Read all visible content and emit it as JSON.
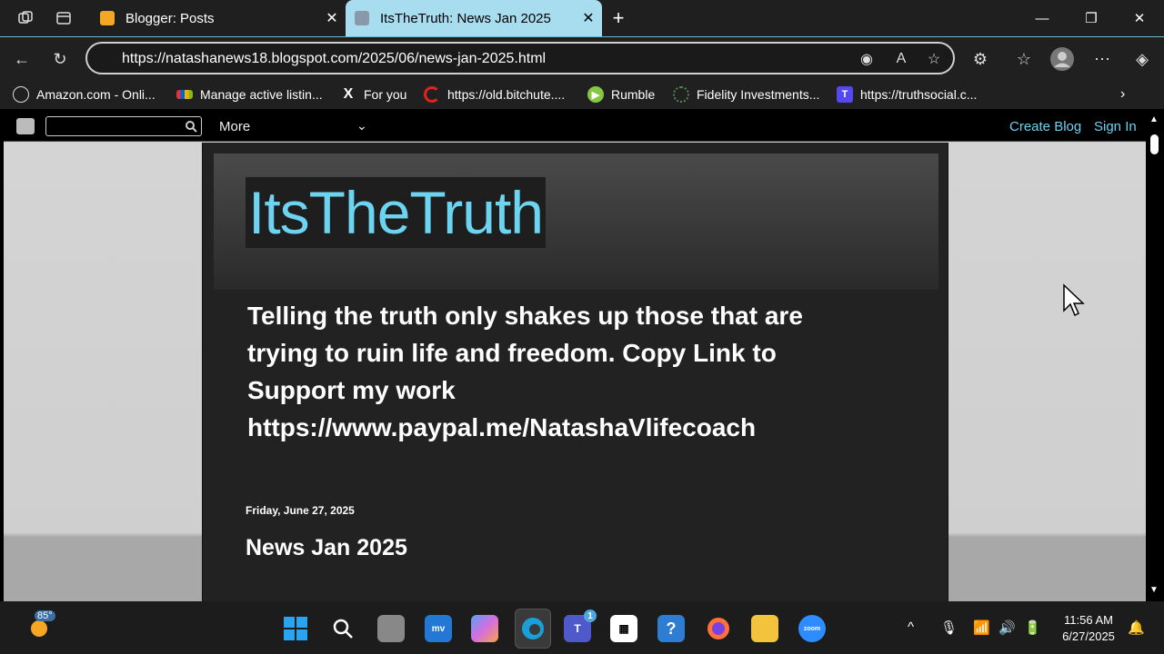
{
  "browser": {
    "tabs": [
      {
        "label": "Blogger: Posts",
        "favicon_color": "#f5a623"
      },
      {
        "label": "ItsTheTruth: News Jan 2025",
        "favicon_color": "#8899aa"
      }
    ],
    "new_tab_label": "+",
    "address": "https://natashanews18.blogspot.com/2025/06/news-jan-2025.html",
    "bookmarks": [
      {
        "label": "Amazon.com - Onli...",
        "icon": "globe-icon"
      },
      {
        "label": "Manage active listin...",
        "icon": "ebay-icon"
      },
      {
        "label": "For you",
        "icon": "x-icon"
      },
      {
        "label": "https://old.bitchute....",
        "icon": "bitchute-icon"
      },
      {
        "label": "Rumble",
        "icon": "rumble-icon"
      },
      {
        "label": "Fidelity Investments...",
        "icon": "fidelity-icon"
      },
      {
        "label": "https://truthsocial.c...",
        "icon": "truthsocial-icon"
      }
    ]
  },
  "blogger_nav": {
    "search_placeholder": "",
    "more_label": "More",
    "create_blog": "Create Blog",
    "sign_in": "Sign In"
  },
  "blog": {
    "title": "ItsTheTruth",
    "description_lines": [
      "Telling the truth only shakes up those that are",
      "trying to ruin life and freedom. Copy Link to",
      "Support my work",
      "https://www.paypal.me/NatashaVlifecoach"
    ],
    "post_date": "Friday, June 27, 2025",
    "post_title": "News Jan 2025"
  },
  "taskbar": {
    "weather_temp": "85°",
    "teams_badge": "1",
    "time": "11:56 AM",
    "date": "6/27/2025"
  },
  "colors": {
    "accent": "#6cd4f0",
    "active_tab": "#a8dcef"
  }
}
